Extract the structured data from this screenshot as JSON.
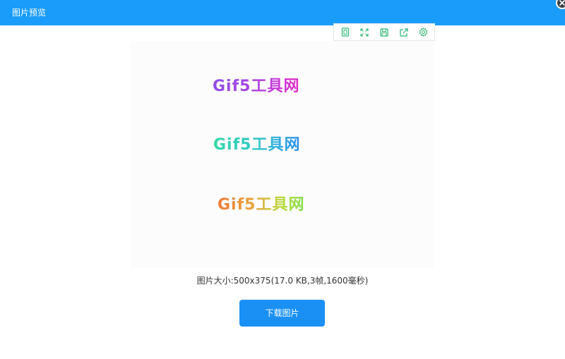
{
  "dialog": {
    "title": "图片预览",
    "close_icon": "close-icon"
  },
  "toolbar": {
    "buttons": [
      {
        "icon": "original-size-icon"
      },
      {
        "icon": "fullscreen-icon"
      },
      {
        "icon": "save-icon"
      },
      {
        "icon": "share-icon"
      },
      {
        "icon": "settings-icon"
      }
    ],
    "accent_color": "#2bb673"
  },
  "preview": {
    "frames_text": [
      "Gif5工具网",
      "Gif5工具网",
      "Gif5工具网"
    ]
  },
  "info": {
    "text": "图片大小:500x375(17.0 KB,3帧,1600毫秒)"
  },
  "download": {
    "label": "下载图片"
  },
  "colors": {
    "header": "#1a9cfb",
    "button": "#1a90f5"
  }
}
